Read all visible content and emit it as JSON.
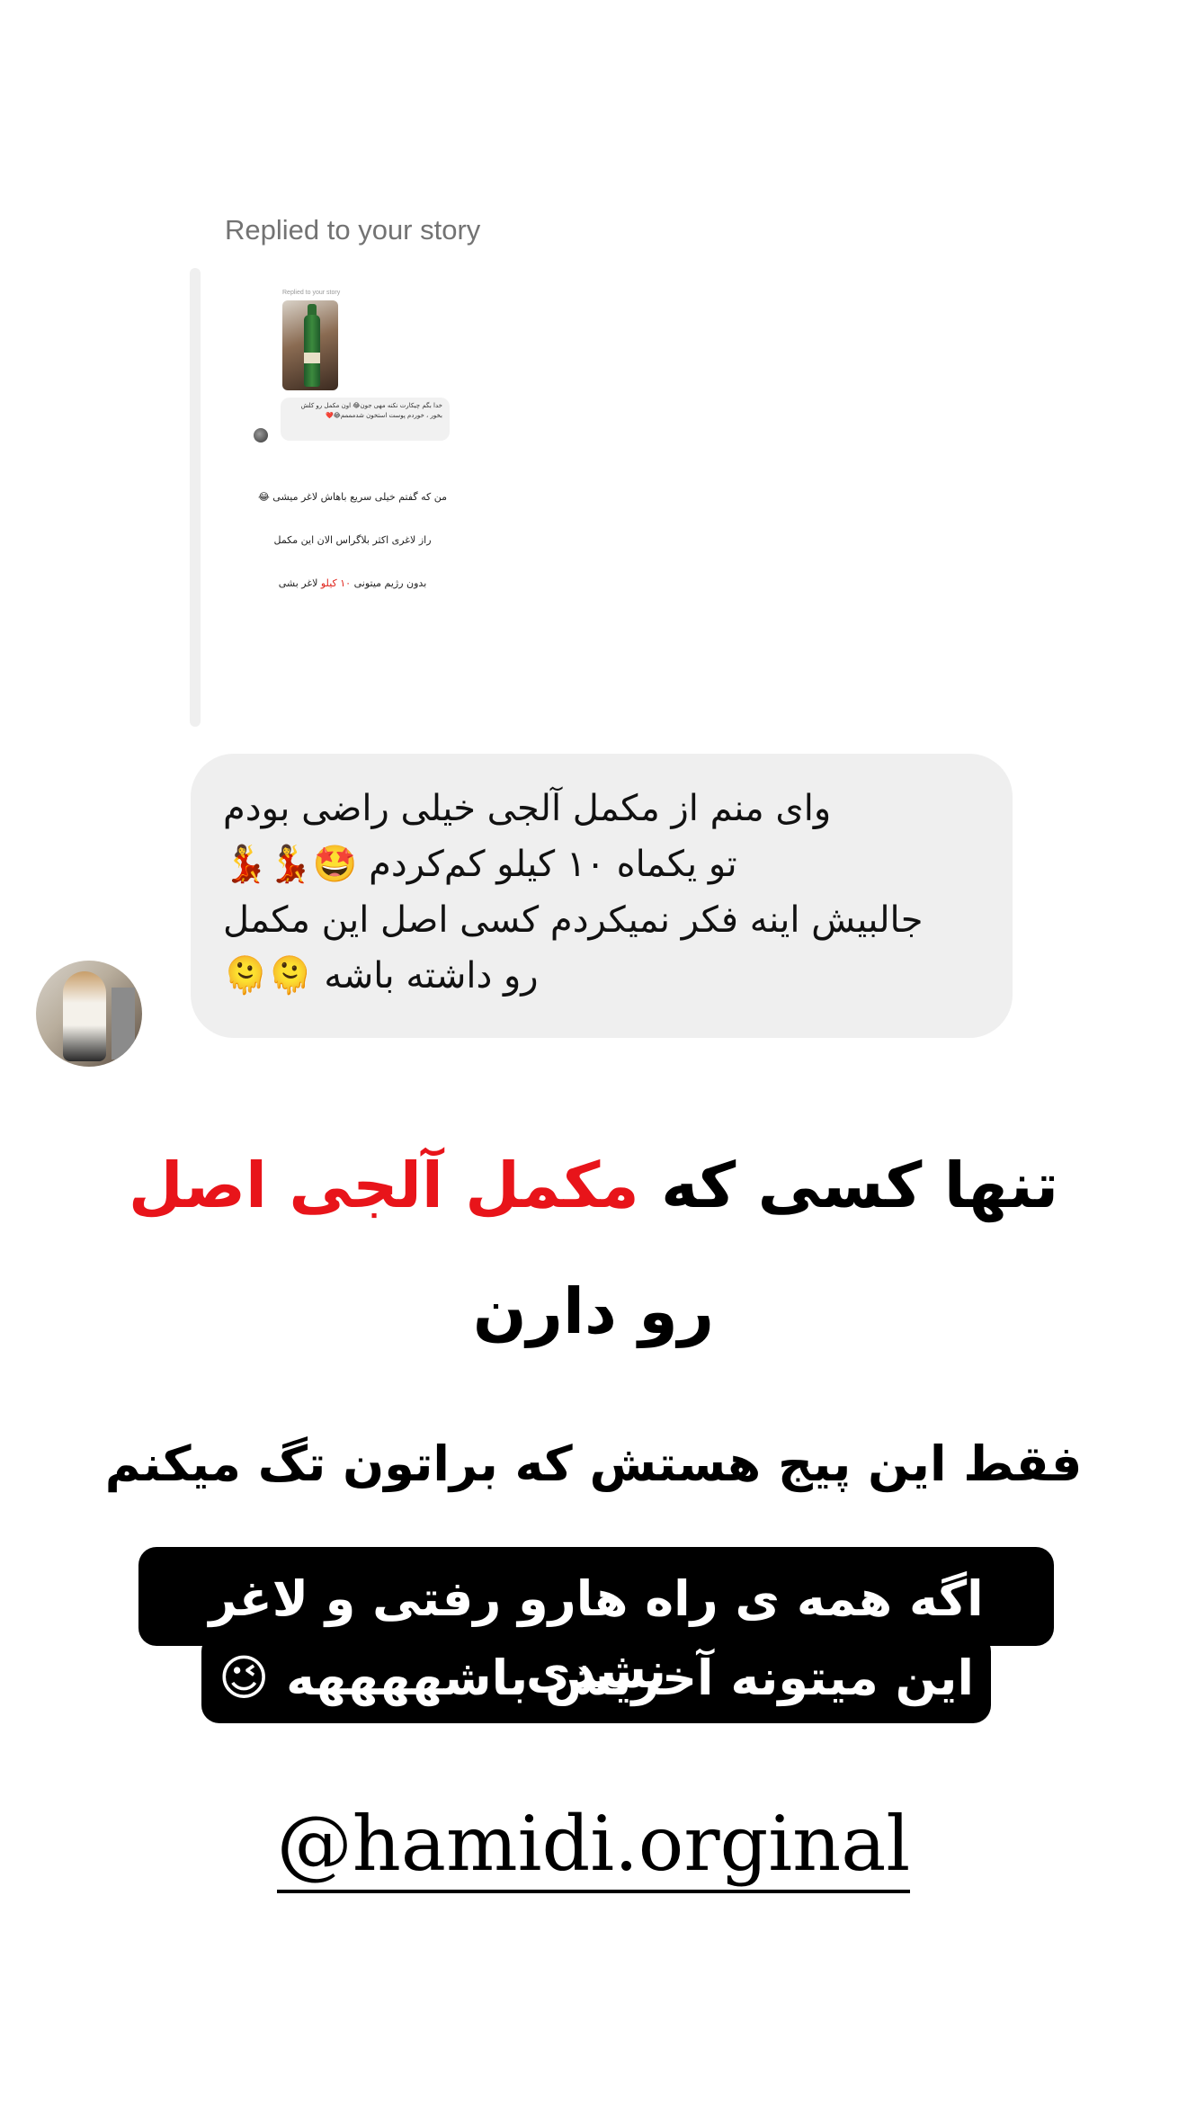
{
  "reply_header": {
    "label": "Replied to your story"
  },
  "quoted_story": {
    "mini_header": "Replied to your story",
    "mini_message": "خدا بگم چیکارت نکنه مهی جون😂 اون مکمل رو کلش بخور ، خوردم پوست استخون شدمممم😂❤️",
    "line1": "من که گفتم خیلی سریع باهاش لاغر میشی 😂",
    "line2": "راز لاغری اکثر بلاگراس الان این مکمل",
    "line3_part1": "بدون رژیم میتونی",
    "line3_red": "۱۰ کیلو",
    "line3_part2": "لاغر بشی"
  },
  "message": {
    "line1": "وای منم از مکمل آلجی خیلی راضی بودم",
    "line2": "تو یکماه ۱۰ کیلو کم‌کردم 🤩💃💃",
    "line3": "جالبیش اینه فکر نمیکردم کسی اصل این مکمل",
    "line4": "رو داشته باشه 🫠🫠"
  },
  "headline": {
    "part1": "تنها کسی که ",
    "red": "مکمل آلجی اصل",
    "part2": "رو دارن"
  },
  "subline": "فقط این پیج هستش که براتون تگ میکنم",
  "highlight": {
    "line1": "اگه همه ی راه هارو رفتی و لاغر نشدی",
    "line2": "این میتونه آخریش باشههههه 😉"
  },
  "handle": "@hamidi.orginal",
  "colors": {
    "accent_red": "#e8141a",
    "bubble_bg": "#efefef",
    "label_gray": "#737373"
  }
}
